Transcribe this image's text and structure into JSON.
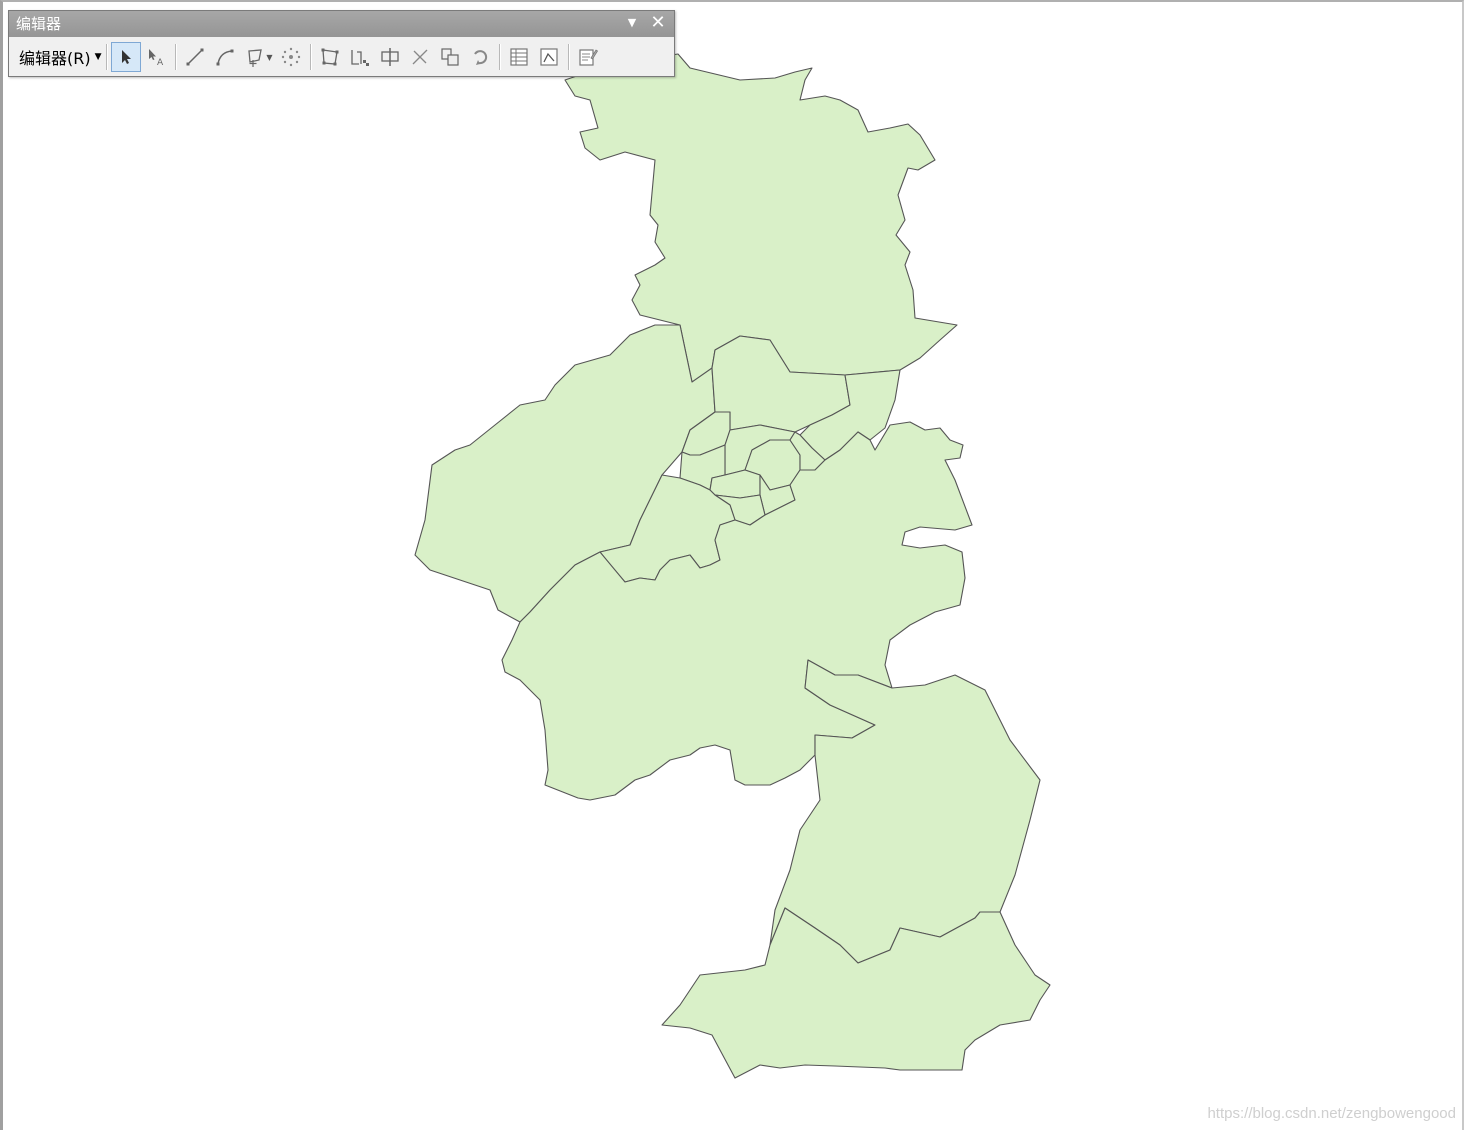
{
  "toolbar": {
    "title": "编辑器",
    "menu_label": "编辑器(R)",
    "dropdown_icon": "chevron-down-icon",
    "close_icon": "close-icon",
    "tools": [
      {
        "name": "edit-tool",
        "icon": "arrow-pointer-icon",
        "active": true
      },
      {
        "name": "edit-annotation-tool",
        "icon": "annotation-arrow-icon",
        "active": false
      },
      {
        "name": "straight-segment-tool",
        "icon": "line-segment-icon",
        "active": false
      },
      {
        "name": "endpoint-arc-tool",
        "icon": "arc-segment-icon",
        "active": false
      },
      {
        "name": "construction-tools",
        "icon": "polygon-construct-icon",
        "active": false,
        "dropdown": true
      },
      {
        "name": "midpoint-tool",
        "icon": "point-scatter-icon",
        "active": false
      },
      {
        "name": "edit-vertices-tool",
        "icon": "edit-vertices-icon",
        "active": false
      },
      {
        "name": "reshape-feature-tool",
        "icon": "reshape-icon",
        "active": false
      },
      {
        "name": "cut-polygons-tool",
        "icon": "cut-polygon-icon",
        "active": false
      },
      {
        "name": "split-tool",
        "icon": "split-icon",
        "active": false
      },
      {
        "name": "copy-features-tool",
        "icon": "copy-features-icon",
        "active": false
      },
      {
        "name": "rotate-tool",
        "icon": "rotate-icon",
        "active": false
      },
      {
        "name": "attributes-tool",
        "icon": "attributes-table-icon",
        "active": false
      },
      {
        "name": "sketch-properties-tool",
        "icon": "sketch-properties-icon",
        "active": false
      },
      {
        "name": "create-features-tool",
        "icon": "create-features-icon",
        "active": false
      }
    ]
  },
  "map": {
    "fill_color": "#d9f0c8",
    "outline_color": "#555555"
  },
  "watermark": "https://blog.csdn.net/zengbowengood"
}
